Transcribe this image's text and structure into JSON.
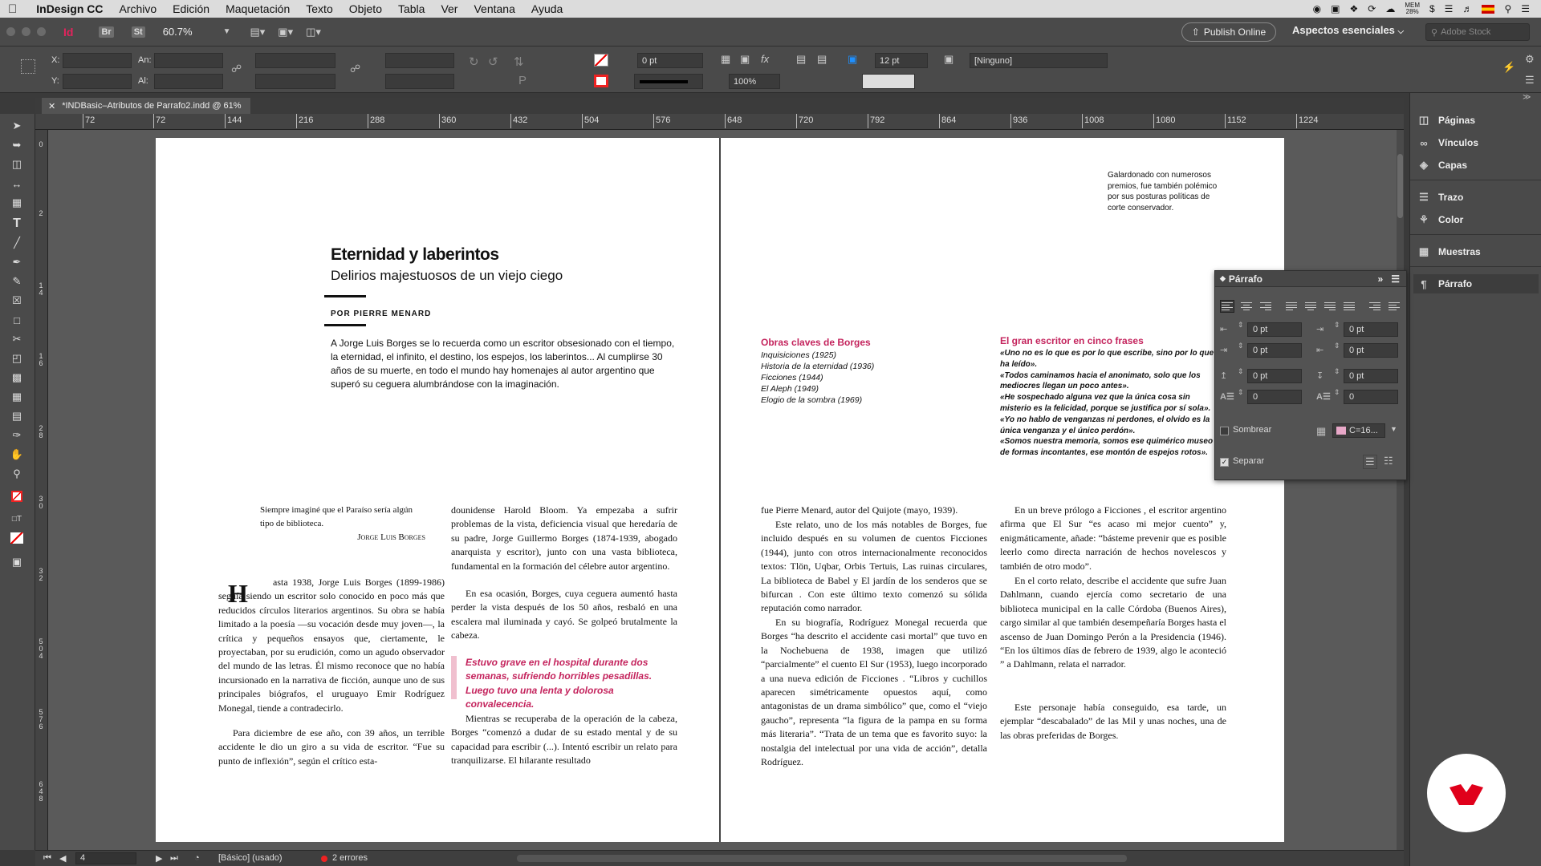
{
  "menubar": {
    "app": "InDesign CC",
    "items": [
      "Archivo",
      "Edición",
      "Maquetación",
      "Texto",
      "Objeto",
      "Tabla",
      "Ver",
      "Ventana",
      "Ayuda"
    ],
    "mem": "MEM",
    "mem_pct": "28%"
  },
  "apptoolbar": {
    "app_badge": "Id",
    "bridge": "Br",
    "stock": "St",
    "zoom": "60.7%",
    "publish": "Publish Online",
    "workspace": "Aspectos esenciales",
    "search_placeholder": "Adobe Stock"
  },
  "control": {
    "x_label": "X:",
    "y_label": "Y:",
    "w_label": "An:",
    "h_label": "Al:",
    "stroke_weight": "0 pt",
    "scale": "100%",
    "gutter": "12 pt",
    "style": "[Ninguno]"
  },
  "document": {
    "tab_title": "*INDBasic–Atributos de Parrafo2.indd @ 61%"
  },
  "ruler": {
    "h": [
      "72",
      "72",
      "144",
      "216",
      "288",
      "360",
      "432",
      "504",
      "576",
      "648",
      "720",
      "792",
      "864",
      "936",
      "1008",
      "1080",
      "1152",
      "1224"
    ],
    "v": [
      "0",
      "2",
      "1 4",
      "1 6",
      "2 8",
      "3 0",
      "3 2",
      "5 0 4",
      "5 7 6",
      "6 4 8"
    ]
  },
  "pageL": {
    "title": "Eternidad y laberintos",
    "subtitle": "Delirios majestuosos de un viejo ciego",
    "byline": "POR PIERRE MENARD",
    "intro": "A Jorge Luis Borges se lo recuerda como un escritor obsesionado con el tiempo, la eternidad, el infinito, el destino, los espejos, los laberintos... Al cumplirse 30 años de su muerte, en todo el mundo hay homenajes al autor argentino que superó su ceguera alumbrándose con la imaginación.",
    "epigraph": "Siempre imaginé que el Paraíso sería algún tipo de biblioteca.",
    "epigraph_author": "Jorge Luis Borges",
    "dropcap": "H",
    "col1": "asta 1938, Jorge Luis Borges (1899-1986) seguía siendo un escritor solo conocido en poco más que reducidos círculos literarios argentinos. Su obra se había limitado a la poesía —su vocación desde muy joven—, la crítica y pequeños ensayos que, ciertamente, le proyectaban, por su erudición, como un agudo observador del mundo de las letras. Él mismo reconoce que no había incursionado en la narrativa de ficción, aunque uno de sus principales biógrafos, el uruguayo Emir Rodríguez Monegal, tiende a contradecirlo.",
    "col1b": "Para diciembre de ese año, con 39 años, un terrible accidente le dio un giro a su vida de escritor. “Fue su punto de inflexión”, según el crítico esta-",
    "col2": "dounidense Harold Bloom. Ya empezaba a sufrir problemas de la vista, deficiencia visual que heredaría de su padre, Jorge Guillermo Borges (1874-1939, abogado anarquista y escritor), junto con una vasta biblioteca, fundamental en la formación del célebre autor argentino.",
    "col2b": "En esa ocasión, Borges, cuya ceguera aumentó hasta perder la vista después de los 50 años, resbaló en una escalera mal iluminada y cayó. Se golpeó brutalmente la cabeza.",
    "pullquote": "Estuvo grave en el hospital durante dos semanas, sufriendo horribles pesadillas. Luego tuvo una lenta y dolorosa convalecencia.",
    "col2c": "Mientras se recuperaba de la operación de la cabeza, Borges “comenzó a dudar de su estado mental y de su capacidad para escribir (...). Intentó escribir un relato para tranquilizarse. El hilarante resultado"
  },
  "pageR": {
    "sidenote": "Galardonado con numerosos premios, fue también polémico por sus posturas políticas de corte conservador.",
    "works_title": "Obras claves de Borges",
    "works": [
      "Inquisiciones (1925)",
      "Historia de la eternidad (1936)",
      "Ficciones (1944)",
      "El Aleph (1949)",
      "Elogio de la sombra (1969)"
    ],
    "quotes_title": "El gran escritor en cinco frases",
    "quotes": [
      "«Uno no es lo que es por lo que escribe, sino por lo que ha leído».",
      "«Todos caminamos hacia el anonimato, solo que los mediocres llegan un poco antes».",
      "«He sospechado alguna vez que la única cosa sin misterio es la felicidad, porque se justifica por sí sola».",
      "«Yo no hablo de venganzas ni perdones, el olvido es la única venganza y el único perdón».",
      "«Somos nuestra memoria, somos ese quimérico museo de formas incontantes, ese montón de espejos rotos»."
    ],
    "col3": "fue Pierre Menard, autor del Quijote (mayo, 1939).",
    "col3b": "Este relato, uno de los más notables de Borges, fue incluido después en su volumen de cuentos Ficciones (1944), junto con otros internacionalmente reconocidos textos: Tlön, Uqbar, Orbis Tertuis, Las ruinas circulares, La biblioteca de Babel y El jardín de los senderos que se bifurcan . Con este último texto comenzó su sólida reputación como narrador.",
    "col3c": "En su biografía, Rodríguez Monegal recuerda que Borges “ha descrito el accidente casi mortal” que tuvo en la Nochebuena de 1938, imagen que utilizó “parcialmente” el cuento El Sur (1953), luego incorporado a una nueva edición de Ficciones . “Libros y cuchillos aparecen simétricamente opuestos aquí, como antagonistas de un drama simbólico” que, como el “viejo gaucho”, representa “la figura de la pampa en su forma más literaria”. “Trata de un tema que es favorito suyo: la nostalgia del intelectual por una vida de acción”, detalla Rodríguez.",
    "col4": "En un breve prólogo a Ficciones , el escritor argentino afirma que El Sur “es acaso mi mejor cuento” y, enigmáticamente, añade: “básteme prevenir que es posible leerlo como directa narración de hechos novelescos y también de otro modo”.",
    "col4b": "En el corto relato, describe el accidente que sufre Juan Dahlmann, cuando ejercía como secretario de una biblioteca municipal en la calle Córdoba (Buenos Aires), cargo similar al que también desempeñaría Borges hasta el ascenso de Juan Domingo Perón a la Presidencia (1946). “En los últimos días de febrero de 1939, algo le aconteció ” a Dahlmann, relata el narrador.",
    "col4c": "Este personaje había conseguido, esa tarde, un ejemplar “descabalado” de las Mil y unas noches, una de las obras preferidas de Borges."
  },
  "dock": {
    "items": [
      "Páginas",
      "Vínculos",
      "Capas",
      "Trazo",
      "Color",
      "Muestras",
      "Párrafo"
    ]
  },
  "parrafo": {
    "title": "Párrafo",
    "indent_left": "0 pt",
    "indent_right": "0 pt",
    "indent_first": "0 pt",
    "indent_last": "0 pt",
    "space_before": "0 pt",
    "space_after": "0 pt",
    "dropcap_lines": "0",
    "dropcap_chars": "0",
    "shade_label": "Sombrear",
    "shade_color": "C=16...",
    "separate_label": "Separar",
    "separate_checked": true,
    "shade_checked": false
  },
  "status": {
    "page": "4",
    "style": "[Básico] (usado)",
    "errors": "2 errores"
  },
  "colors": {
    "accent": "#c4245d",
    "pull_bar": "#f0c0cf",
    "logo": "#e0001b"
  }
}
